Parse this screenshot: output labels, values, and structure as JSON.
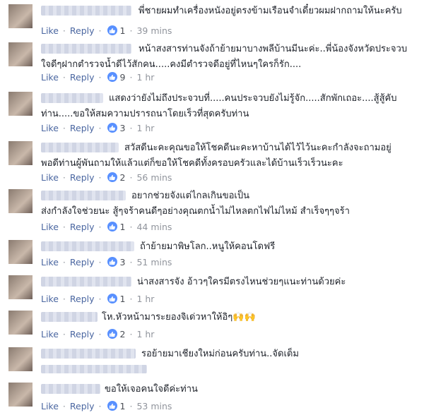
{
  "actions": {
    "like": "Like",
    "reply": "Reply",
    "separator": "·"
  },
  "colors": {
    "link": "#4b67a1",
    "like_badge": "#5890ff"
  },
  "comments": [
    {
      "text": "พี่ชายผมทำเครื่องหนังอยู่ตรงข้ามเรือนจำเดี๋ยวผมฝากถามให้นะครับ",
      "likes": "1",
      "time": "39 mins"
    },
    {
      "text": "หน้าสงสารท่านจังถ้าย้ายมาบางพลีบ้านมีนะค่ะ..พี่น้องจังหวัดประจวบ\nใจดีๆฝากตำรวจน้ำดีไว้สักคน.....คงมีตำรวจดีอยู่ที่ไหนๆใครก็รัก....",
      "likes": "9",
      "time": "1 hr"
    },
    {
      "text": "แสดงว่ายังไม่ถึงประจวบที่.....คนประจวบยังไม่รู้จัก.....สักพักเถอะ....สู้สู้คับ\nท่าน.....ขอให้สมความปรารถนาโดยเร็วที่สุดครับท่าน",
      "likes": "3",
      "time": "1 hr"
    },
    {
      "text": "สวัสดีนะคะคุณขอให้โชคดีนะคะหาบ้านได้ไว้ไว้นะคะกำลังจะถามอยู่\nพอดีท่านผู้พันถามให้แล้วแต่ก็ขอให้โชคดีทั้งครอบครัวและได้บ้านเร็วเร็วนะคะ",
      "likes": "2",
      "time": "56 mins"
    },
    {
      "text": "อยากช่วยจังแต่ไกลเกินขอเป็น\nส่งกำลังใจช่วยนะ สู้ๆจร้าคนดีๆอย่างคุณตกน้ำไม่ไหลตกไฟไม่ไหม้ สำเร็จๆๆจร้า",
      "likes": "1",
      "time": "44 mins"
    },
    {
      "text": "ถ้าย้ายมาพิษโลก..หนูให้คอนโดฟรี",
      "likes": "3",
      "time": "51 mins"
    },
    {
      "text": "น่าสงสารจัง อ้าวๆใครมีตรงไหนช่วยๆแนะท่านด้วยค่ะ",
      "likes": "1",
      "time": "1 hr"
    },
    {
      "text": "โห.หัวหน้ามาระยองจิเด่วหาให้อิๆ🙌🙌",
      "likes": "2",
      "time": "1 hr"
    },
    {
      "text": "รอย้ายมาเชียงใหม่ก่อนครับท่าน..จัดเต็ม",
      "likes": "",
      "time": ""
    },
    {
      "text": "ขอให้เจอคนใจดีค่ะท่าน",
      "likes": "1",
      "time": "53 mins"
    }
  ]
}
